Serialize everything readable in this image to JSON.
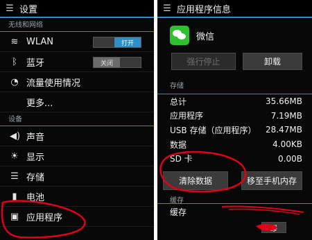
{
  "left": {
    "title": "设置",
    "sections": {
      "wireless": "无线和网络",
      "device": "设备"
    },
    "items": {
      "wlan": {
        "label": "WLAN",
        "toggle": "打开"
      },
      "bluetooth": {
        "label": "蓝牙",
        "toggle": "关闭"
      },
      "data_usage": {
        "label": "流量使用情况"
      },
      "more": {
        "label": "更多..."
      },
      "sound": {
        "label": "声音"
      },
      "display": {
        "label": "显示"
      },
      "storage": {
        "label": "存储"
      },
      "battery": {
        "label": "电池"
      },
      "apps": {
        "label": "应用程序"
      }
    }
  },
  "right": {
    "title": "应用程序信息",
    "app_name": "微信",
    "buttons": {
      "force_stop": "强行停止",
      "uninstall": "卸载",
      "clear_data": "清除数据",
      "move_to_phone": "移至手机内存",
      "clear_cache": "缪"
    },
    "storage_section": "存储",
    "storage": [
      {
        "label": "总计",
        "value": "35.66MB"
      },
      {
        "label": "应用程序",
        "value": "7.19MB"
      },
      {
        "label": "USB 存储（应用程序）",
        "value": "28.47MB"
      },
      {
        "label": "数据",
        "value": "4.00KB"
      },
      {
        "label": "SD 卡",
        "value": "0.00B"
      }
    ],
    "cache_section": "缓存",
    "cache_label": "缓存"
  },
  "colors": {
    "accent": "#2b8cc4",
    "annotation": "#e0001a",
    "wechat": "#2fbf2f"
  }
}
